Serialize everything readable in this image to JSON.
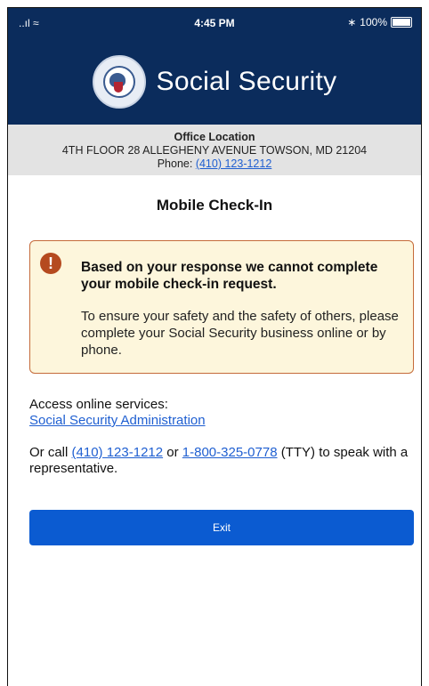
{
  "status_bar": {
    "signal": "..ıl ≈",
    "time": "4:45 PM",
    "bluetooth": "∗",
    "battery": "100%"
  },
  "header": {
    "title": "Social Security",
    "logo": "ssa-seal-icon"
  },
  "office": {
    "label": "Office Location",
    "address": "4TH FLOOR 28 ALLEGHENY AVENUE TOWSON, MD 21204",
    "phone_prefix": "Phone:",
    "phone": "(410) 123-1212"
  },
  "page_title": "Mobile Check-In",
  "alert": {
    "icon": "exclamation-icon",
    "heading": "Based on your response we cannot complete your mobile check-in request.",
    "body": "To ensure your safety and the safety of others, please complete your Social Security business online or by phone."
  },
  "online_services": {
    "label": "Access online services:",
    "link": "Social Security Administration"
  },
  "call": {
    "prefix": "Or call",
    "phone": "(410) 123-1212",
    "or": "or",
    "tty_phone": "1-800-325-0778",
    "suffix": "(TTY) to speak with a representative."
  },
  "exit_button": "Exit",
  "colors": {
    "navy": "#0b2c5c",
    "button_blue": "#0b5bd1",
    "alert_border": "#c56b3a",
    "alert_bg": "#fdf6dc",
    "link": "#1f5fd1"
  }
}
